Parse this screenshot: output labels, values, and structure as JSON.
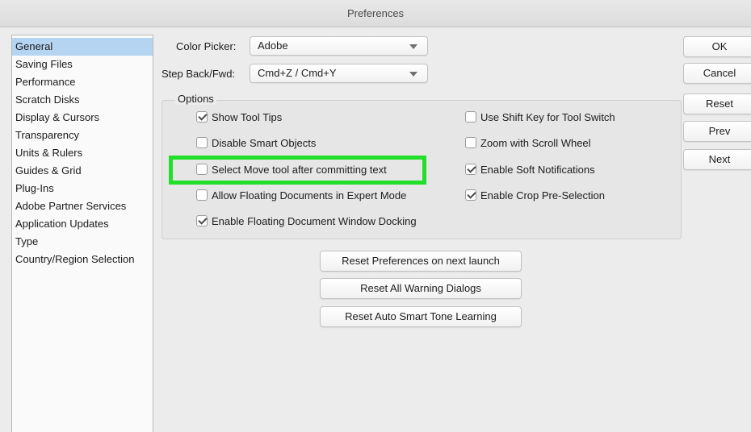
{
  "window": {
    "title": "Preferences"
  },
  "sidebar": {
    "items": [
      {
        "label": "General",
        "selected": true
      },
      {
        "label": "Saving Files"
      },
      {
        "label": "Performance"
      },
      {
        "label": "Scratch Disks"
      },
      {
        "label": "Display & Cursors"
      },
      {
        "label": "Transparency"
      },
      {
        "label": "Units & Rulers"
      },
      {
        "label": "Guides & Grid"
      },
      {
        "label": "Plug-Ins"
      },
      {
        "label": "Adobe Partner Services"
      },
      {
        "label": "Application Updates"
      },
      {
        "label": "Type"
      },
      {
        "label": "Country/Region Selection"
      }
    ]
  },
  "color_picker": {
    "label": "Color Picker:",
    "value": "Adobe"
  },
  "step_back": {
    "label": "Step Back/Fwd:",
    "value": "Cmd+Z / Cmd+Y"
  },
  "options": {
    "title": "Options",
    "left": [
      {
        "label": "Show Tool Tips",
        "checked": true
      },
      {
        "label": "Disable Smart Objects",
        "checked": false
      },
      {
        "label": "Select Move tool after committing text",
        "checked": false
      },
      {
        "label": "Allow Floating Documents in Expert Mode",
        "checked": false
      },
      {
        "label": "Enable Floating Document Window Docking",
        "checked": true
      }
    ],
    "right": [
      {
        "label": "Use Shift Key for Tool Switch",
        "checked": false
      },
      {
        "label": "Zoom with Scroll Wheel",
        "checked": false
      },
      {
        "label": "Enable Soft Notifications",
        "checked": true
      },
      {
        "label": "Enable Crop Pre-Selection",
        "checked": true
      }
    ]
  },
  "reset_buttons": {
    "preferences": "Reset Preferences on next launch",
    "warnings": "Reset All Warning Dialogs",
    "smart_tone": "Reset Auto Smart Tone Learning"
  },
  "side_buttons": {
    "ok": "OK",
    "cancel": "Cancel",
    "reset": "Reset",
    "prev": "Prev",
    "next": "Next"
  },
  "colors": {
    "highlight": "#22e02a",
    "selection": "#b5d4f2"
  }
}
